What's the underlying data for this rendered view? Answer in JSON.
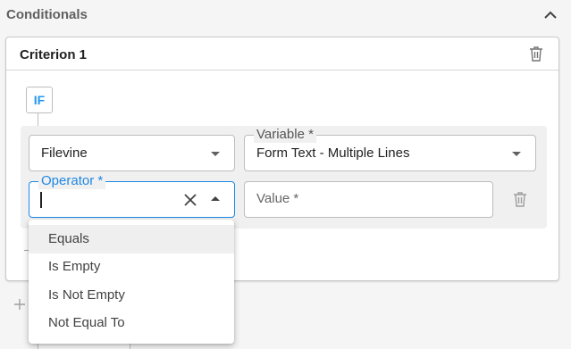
{
  "section": {
    "title": "Conditionals"
  },
  "criterion": {
    "title": "Criterion 1"
  },
  "condition": {
    "if_label": "IF"
  },
  "fields": {
    "source": {
      "value": "Filevine"
    },
    "variable": {
      "label": "Variable *",
      "value": "Form Text - Multiple Lines"
    },
    "operator": {
      "label": "Operator *",
      "value": ""
    },
    "value": {
      "placeholder": "Value *"
    }
  },
  "operator_options": [
    "Equals",
    "Is Empty",
    "Is Not Empty",
    "Not Equal To"
  ],
  "colors": {
    "accent": "#1e88e5",
    "if_badge": "#2196f3"
  },
  "icons": [
    "chevron-up-icon",
    "trash-icon",
    "clear-x-icon",
    "dropdown-arrow-icon",
    "plus-icon"
  ]
}
